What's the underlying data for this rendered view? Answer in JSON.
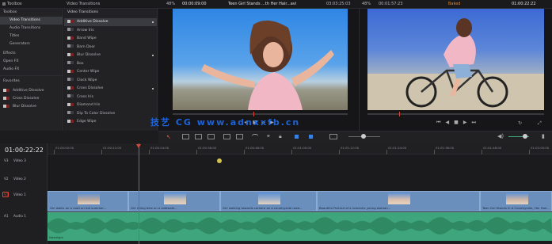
{
  "topbar": {
    "toolbox_label": "Toolbox",
    "transitions_header": "Video Transitions",
    "zoom_left": "48%",
    "tc_left": "00:00:09:00",
    "clip_title": "Teen Girl Stands ...th Her Hair...avi",
    "tc_mid": "03:03:25:03",
    "zoom_right": "48%",
    "tc_right_a": "00:01:57:23",
    "timeline_name": "Baked",
    "tc_right_b": "01:00:22:22"
  },
  "toolbox": {
    "items": [
      "Toolbox",
      "Video Transitions",
      "Audio Transitions",
      "Titles",
      "Generators",
      "Effects",
      "Open FX",
      "Audio FX"
    ]
  },
  "favorites": {
    "header": "Favorites",
    "items": [
      "Additive Dissolve",
      "Cross Dissolve",
      "Blur Dissolve"
    ]
  },
  "transitions": {
    "header": "Video Transitions",
    "items": [
      {
        "label": "Additive Dissolve",
        "fav": true
      },
      {
        "label": "Arrow Iris",
        "fav": false
      },
      {
        "label": "Band Wipe",
        "fav": false
      },
      {
        "label": "Barn Door",
        "fav": false
      },
      {
        "label": "Blur Dissolve",
        "fav": true
      },
      {
        "label": "Box",
        "fav": false
      },
      {
        "label": "Center Wipe",
        "fav": false
      },
      {
        "label": "Clock Wipe",
        "fav": false
      },
      {
        "label": "Cross Dissolve",
        "fav": true
      },
      {
        "label": "Cross Iris",
        "fav": false
      },
      {
        "label": "Diamond Iris",
        "fav": false
      },
      {
        "label": "Dip To Color Dissolve",
        "fav": false
      },
      {
        "label": "Edge Wipe",
        "fav": false
      }
    ]
  },
  "timeline": {
    "timecode": "01:00:22:22",
    "ruler_labels": [
      "01:00:00:00",
      "01:00:12:00",
      "01:00:24:00",
      "01:00:36:00",
      "01:00:48:00",
      "01:01:00:00",
      "01:01:12:00",
      "01:01:24:00",
      "01:01:36:00",
      "01:01:48:00",
      "01:02:00:00",
      "01:02:12:00"
    ],
    "tracks": [
      {
        "id": "V3",
        "name": "Video 3"
      },
      {
        "id": "V2",
        "name": "Video 2"
      },
      {
        "id": "V1",
        "name": "Video 1"
      },
      {
        "id": "A1",
        "name": "Audio 1"
      }
    ],
    "clips": [
      {
        "label": "Girl walks on a road on hot summer..."
      },
      {
        "label": "Girl riding bike on a sidewalk..."
      },
      {
        "label": "Girl walking towards camera on a countryside road..."
      },
      {
        "label": "Beautiful Portrait of a romantic young woman..."
      },
      {
        "label": "Teen Girl Stands In A Countryside, Her Hair..."
      }
    ],
    "audio_label": "Nostalgia"
  },
  "watermark": "技艺 CG www.adnxxfb.cn",
  "icons": [
    "play-icon",
    "stop-icon",
    "prev-frame-icon",
    "next-frame-icon",
    "loop-icon",
    "cut-icon",
    "link-icon",
    "flag-icon",
    "zoom-icon",
    "volume-icon",
    "search-icon"
  ],
  "colors": {
    "accent": "#3a82e0",
    "playhead": "#d9483a",
    "video_clip": "#6a8fbd",
    "audio_clip": "#3fa57c"
  }
}
